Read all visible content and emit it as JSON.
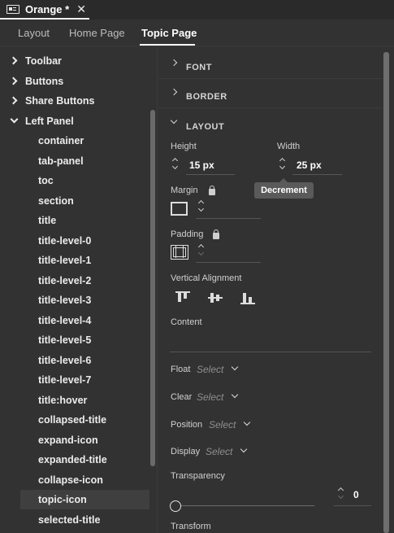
{
  "document_tab": {
    "title": "Orange *",
    "close": "✕"
  },
  "page_tabs": [
    {
      "label": "Layout"
    },
    {
      "label": "Home Page"
    },
    {
      "label": "Topic Page"
    }
  ],
  "tree": {
    "parents": [
      {
        "label": "Toolbar"
      },
      {
        "label": "Buttons"
      },
      {
        "label": "Share Buttons"
      },
      {
        "label": "Left Panel"
      }
    ],
    "children": [
      {
        "label": "container"
      },
      {
        "label": "tab-panel"
      },
      {
        "label": "toc"
      },
      {
        "label": "section"
      },
      {
        "label": "title"
      },
      {
        "label": "title-level-0"
      },
      {
        "label": "title-level-1"
      },
      {
        "label": "title-level-2"
      },
      {
        "label": "title-level-3"
      },
      {
        "label": "title-level-4"
      },
      {
        "label": "title-level-5"
      },
      {
        "label": "title-level-6"
      },
      {
        "label": "title-level-7"
      },
      {
        "label": "title:hover"
      },
      {
        "label": "collapsed-title"
      },
      {
        "label": "expand-icon"
      },
      {
        "label": "expanded-title"
      },
      {
        "label": "collapse-icon"
      },
      {
        "label": "topic-icon"
      },
      {
        "label": "selected-title"
      }
    ],
    "selected": "topic-icon"
  },
  "sections": {
    "font": "FONT",
    "border": "BORDER",
    "layout": "LAYOUT"
  },
  "layout": {
    "height_label": "Height",
    "height_value": "15 px",
    "width_label": "Width",
    "width_value": "25 px",
    "tooltip": "Decrement",
    "margin_label": "Margin",
    "padding_label": "Padding",
    "valign_label": "Vertical Alignment",
    "content_label": "Content",
    "float_label": "Float",
    "float_value": "Select",
    "clear_label": "Clear",
    "clear_value": "Select",
    "position_label": "Position",
    "position_value": "Select",
    "display_label": "Display",
    "display_value": "Select",
    "transparency_label": "Transparency",
    "transparency_value": "0",
    "transform_label": "Transform"
  }
}
